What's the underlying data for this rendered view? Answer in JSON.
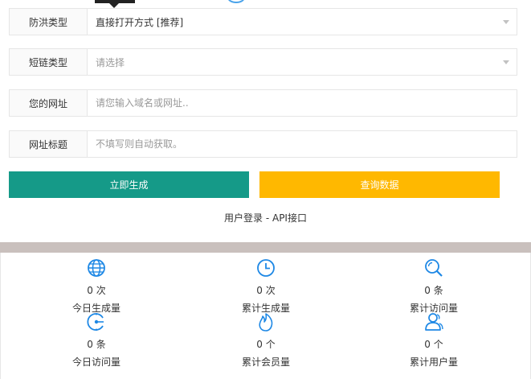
{
  "form": {
    "fields": [
      {
        "label": "防洪类型",
        "value": "直接打开方式 [推荐]",
        "type": "select"
      },
      {
        "label": "短链类型",
        "placeholder": "请选择",
        "type": "select"
      },
      {
        "label": "您的网址",
        "placeholder": "请您输入域名或网址..",
        "type": "input"
      },
      {
        "label": "网址标题",
        "placeholder": "不填写则自动获取。",
        "type": "input"
      }
    ],
    "generate_label": "立即生成",
    "query_label": "查询数据",
    "login_link": "用户登录",
    "separator": " - ",
    "api_link": "API接口"
  },
  "colors": {
    "generate_button": "#159a88",
    "query_button": "#ffb800",
    "icon_blue": "#1e88e5",
    "divider": "#c9c0bd"
  },
  "stats": [
    {
      "icon": "globe-icon",
      "value": "0 次",
      "label": "今日生成量"
    },
    {
      "icon": "clock-icon",
      "value": "0 次",
      "label": "累计生成量"
    },
    {
      "icon": "search-icon",
      "value": "0 条",
      "label": "累计访问量"
    },
    {
      "icon": "dial-icon",
      "value": "0 条",
      "label": "今日访问量"
    },
    {
      "icon": "flame-icon",
      "value": "0 个",
      "label": "累计会员量"
    },
    {
      "icon": "users-icon",
      "value": "0 个",
      "label": "累计用户量"
    }
  ]
}
